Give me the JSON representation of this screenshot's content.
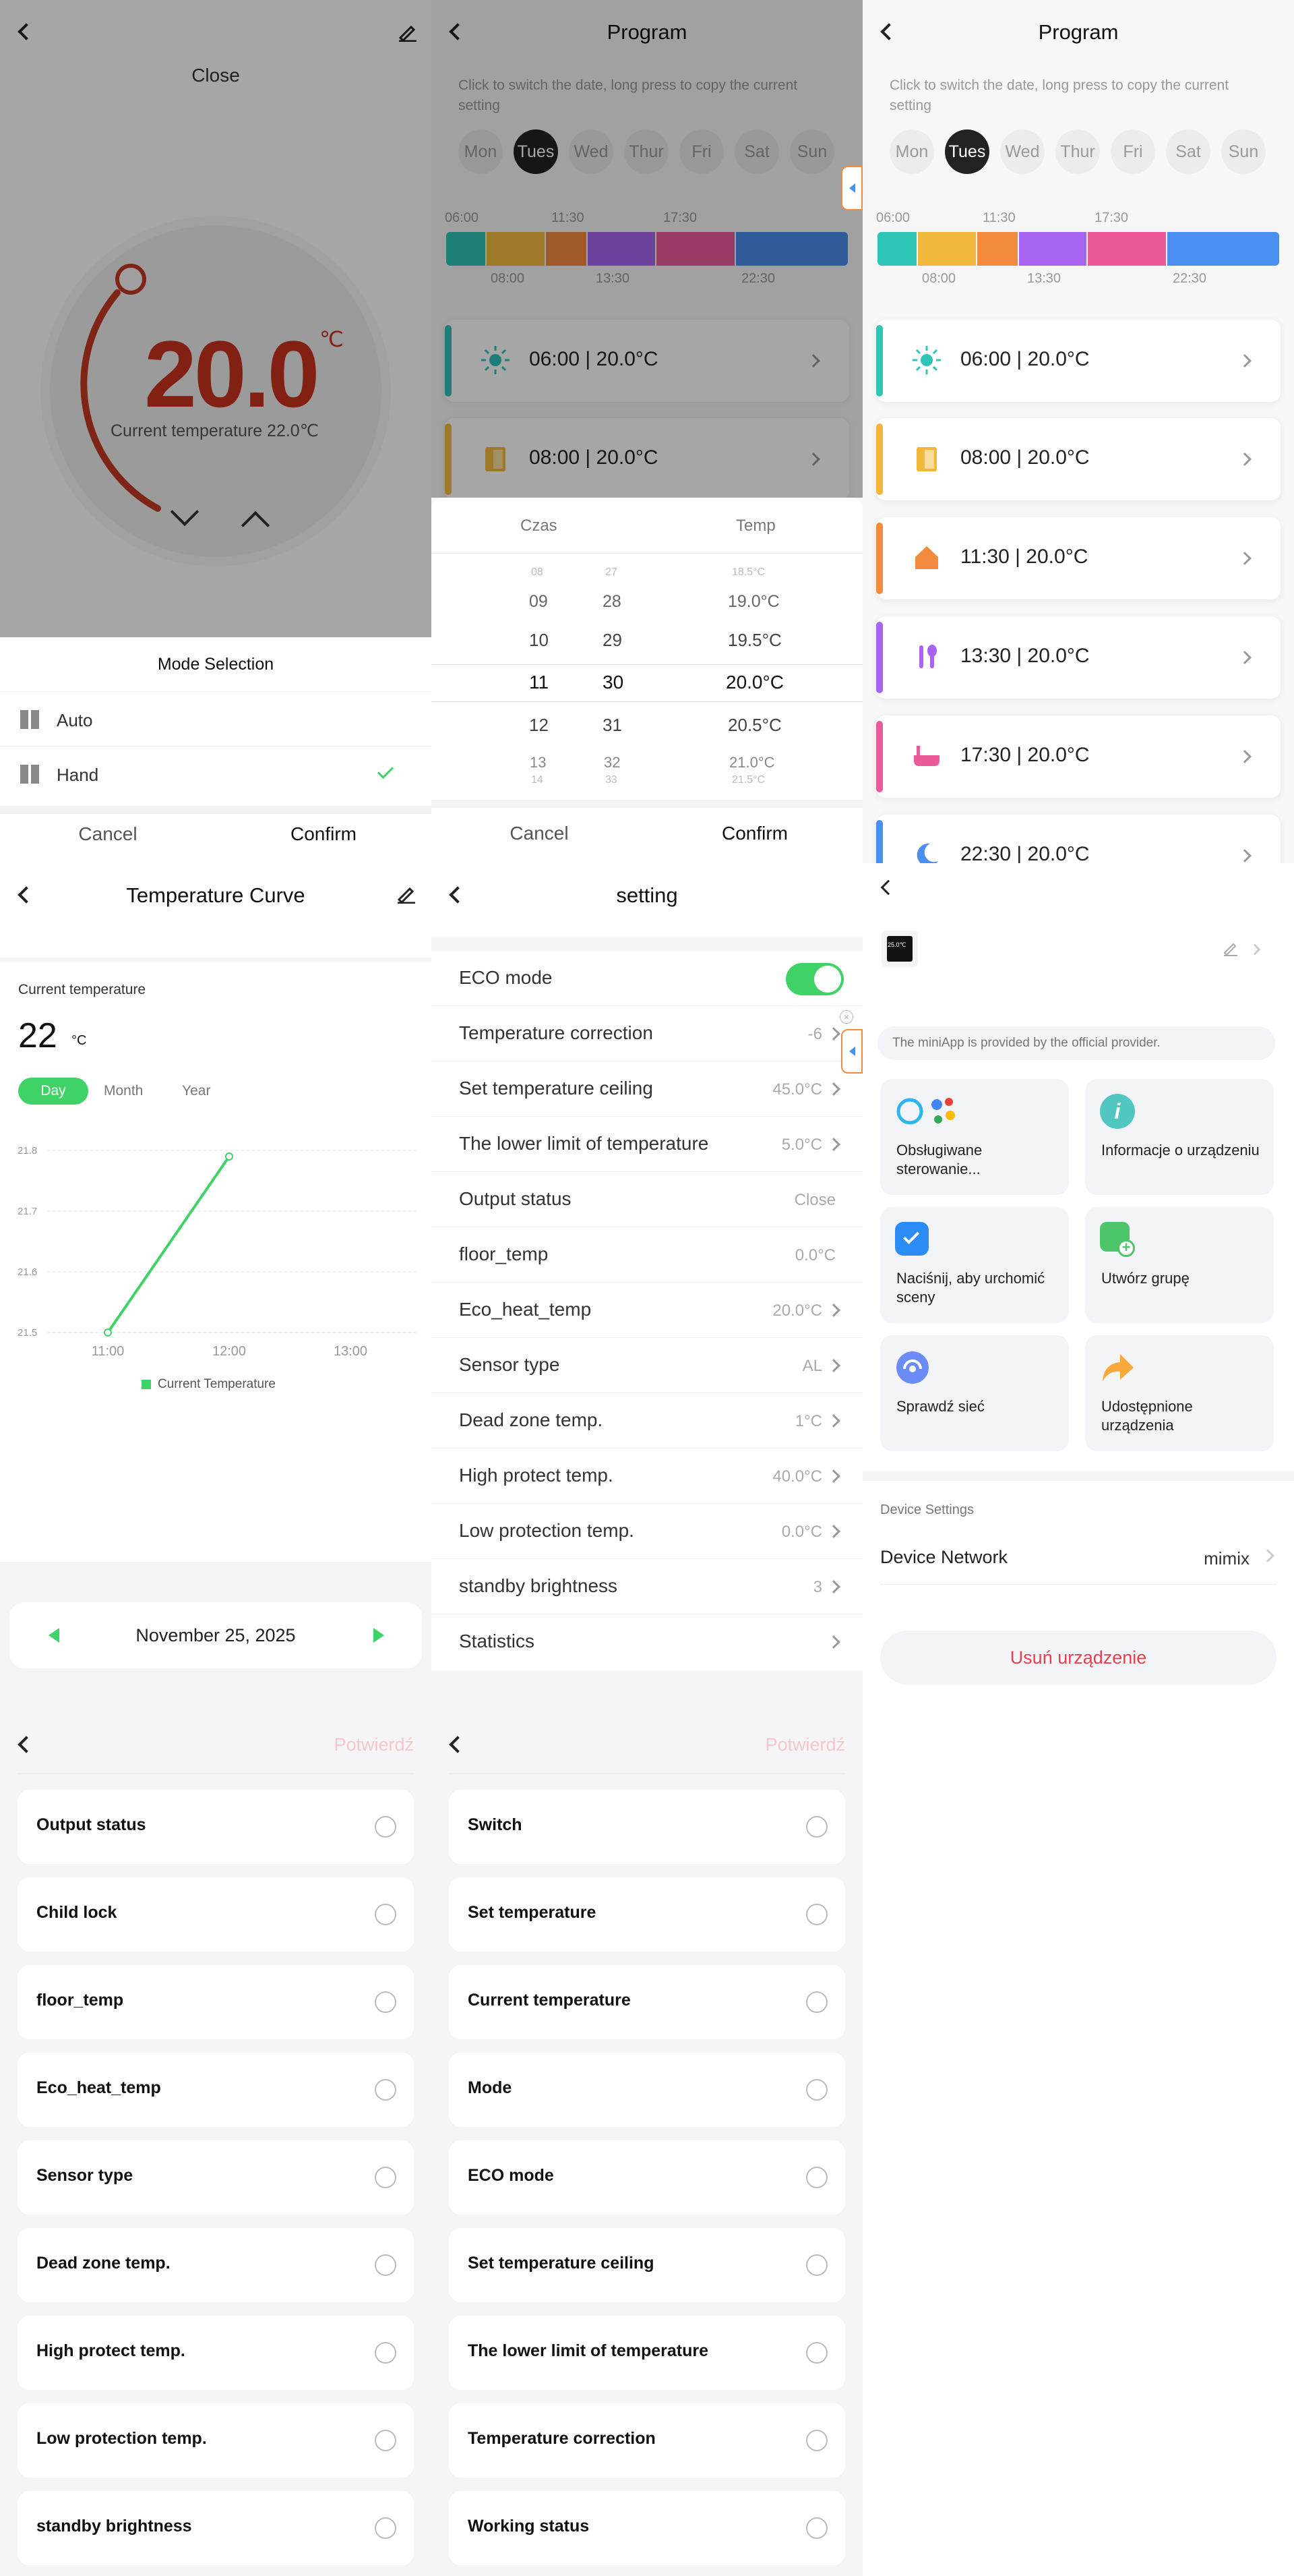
{
  "mode_screen": {
    "status": "Close",
    "set_temp": "20.0",
    "unit": "℃",
    "current_label": "Current temperature 22.0℃",
    "sheet_title": "Mode Selection",
    "options": [
      "Auto",
      "Hand"
    ],
    "cancel": "Cancel",
    "confirm": "Confirm"
  },
  "program": {
    "title": "Program",
    "hint": "Click to switch the date, long press to copy the current setting",
    "days": [
      "Mon",
      "Tues",
      "Wed",
      "Thur",
      "Fri",
      "Sat",
      "Sun"
    ],
    "ticks_top": [
      "06:00",
      "11:30",
      "17:30"
    ],
    "ticks_bottom": [
      "08:00",
      "13:30",
      "22:30"
    ],
    "colors": {
      "s1": "#2ec4b6",
      "s2": "#f2b83e",
      "s3": "#f28b3e",
      "s4": "#a764f0",
      "s5": "#ec5a9b",
      "s6": "#4a8ef0"
    },
    "entries": [
      "06:00  |  20.0°C",
      "08:00  |  20.0°C",
      "11:30  |  20.0°C",
      "13:30  |  20.0°C",
      "17:30  |  20.0°C",
      "22:30  |  20.0°C"
    ]
  },
  "picker": {
    "col_time": "Czas",
    "col_temp": "Temp",
    "hours": [
      "08",
      "09",
      "10",
      "11",
      "12",
      "13",
      "14"
    ],
    "mins": [
      "27",
      "28",
      "29",
      "30",
      "31",
      "32",
      "33"
    ],
    "temps": [
      "18.5°C",
      "19.0°C",
      "19.5°C",
      "20.0°C",
      "20.5°C",
      "21.0°C",
      "21.5°C"
    ],
    "cancel": "Cancel",
    "confirm": "Confirm"
  },
  "curve": {
    "title": "Temperature Curve",
    "cur_label": "Current temperature",
    "cur_value": "22",
    "cur_unit": "°C",
    "tabs": [
      "Day",
      "Month",
      "Year"
    ],
    "date": "November 25, 2025",
    "chart_data": {
      "type": "line",
      "x": [
        "11:00",
        "12:00"
      ],
      "series": [
        {
          "name": "Current Temperature",
          "values": [
            21.5,
            21.79
          ]
        }
      ],
      "yticks": [
        "21.8",
        "21.7",
        "21.6",
        "21.5"
      ],
      "xticks": [
        "11:00",
        "12:00",
        "13:00"
      ],
      "ylim": [
        21.5,
        21.8
      ],
      "color": "#3fd267"
    }
  },
  "setting": {
    "title": "setting",
    "rows": [
      {
        "label": "ECO mode",
        "value": ""
      },
      {
        "label": "Temperature correction",
        "value": "-6"
      },
      {
        "label": "Set temperature ceiling",
        "value": "45.0°C"
      },
      {
        "label": "The lower limit of temperature",
        "value": "5.0°C"
      },
      {
        "label": "Output status",
        "value": "Close"
      },
      {
        "label": "floor_temp",
        "value": "0.0°C"
      },
      {
        "label": "Eco_heat_temp",
        "value": "20.0°C"
      },
      {
        "label": "Sensor type",
        "value": "AL"
      },
      {
        "label": "Dead zone temp.",
        "value": "1°C"
      },
      {
        "label": "High protect temp.",
        "value": "40.0°C"
      },
      {
        "label": "Low protection temp.",
        "value": "0.0°C"
      },
      {
        "label": "standby brightness",
        "value": "3"
      },
      {
        "label": "Statistics",
        "value": ""
      }
    ]
  },
  "device": {
    "device_thumb": "25.0℃",
    "notice": "The miniApp is provided by the official provider.",
    "tiles": [
      "Obsługiwane sterowanie...",
      "Informacje o urządzeniu",
      "Naciśnij, aby urchomić sceny",
      "Utwórz grupę",
      "Sprawdź sieć",
      "Udostępnione urządzenia"
    ],
    "section": "Device Settings",
    "network_label": "Device Network",
    "network_value": "mimix",
    "remove": "Usuń urządzenie"
  },
  "select_left": {
    "confirm": "Potwierdź",
    "items": [
      "Output status",
      "Child lock",
      "floor_temp",
      "Eco_heat_temp",
      "Sensor type",
      "Dead zone temp.",
      "High protect temp.",
      "Low protection temp.",
      "standby brightness"
    ]
  },
  "select_right": {
    "confirm": "Potwierdź",
    "items": [
      "Switch",
      "Set temperature",
      "Current temperature",
      "Mode",
      "ECO mode",
      "Set temperature ceiling",
      "The lower limit of temperature",
      "Temperature correction",
      "Working status"
    ]
  }
}
